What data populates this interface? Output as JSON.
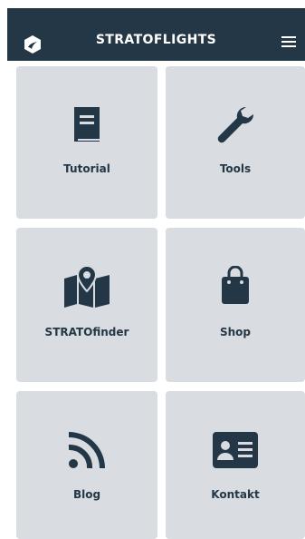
{
  "header": {
    "title": "STRATOFLIGHTS",
    "logo_icon": "stratoflights-logo-icon",
    "menu_icon": "hamburger-menu-icon",
    "background": "#243746"
  },
  "tiles": [
    {
      "label": "Tutorial",
      "icon": "book-icon"
    },
    {
      "label": "Tools",
      "icon": "wrench-icon"
    },
    {
      "label": "STRATOfinder",
      "icon": "map-pin-icon"
    },
    {
      "label": "Shop",
      "icon": "shopping-bag-icon"
    },
    {
      "label": "Blog",
      "icon": "rss-icon"
    },
    {
      "label": "Kontakt",
      "icon": "contact-card-icon"
    }
  ],
  "colors": {
    "tile_background": "#d9dce0",
    "icon_color": "#243746"
  }
}
